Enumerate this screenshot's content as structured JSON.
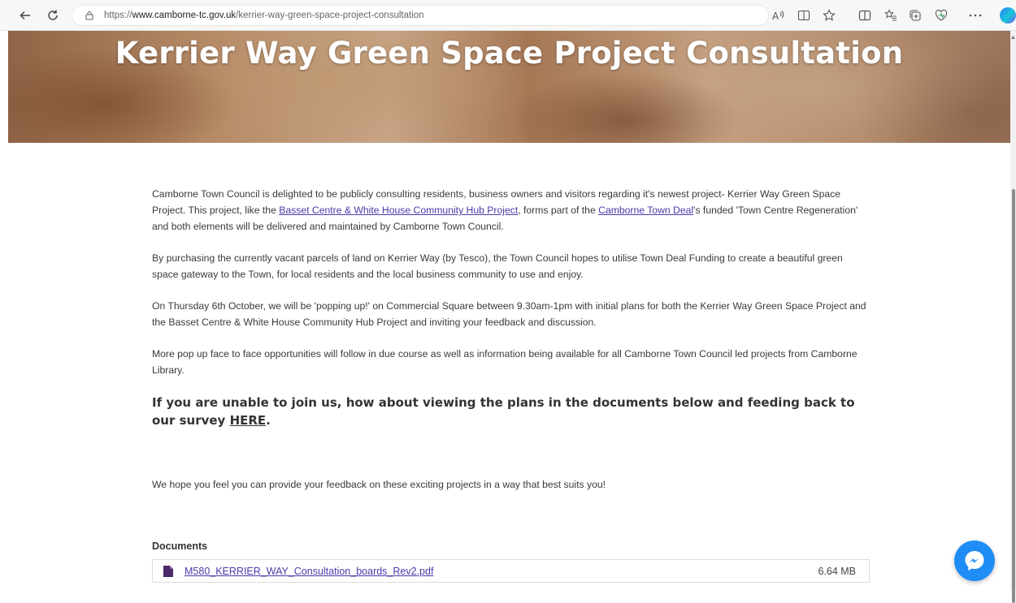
{
  "browser": {
    "url_scheme": "https://",
    "url_host": "www.camborne-tc.gov.uk",
    "url_path": "/kerrier-way-green-space-project-consultation",
    "toolbar_icons": [
      "read-aloud-icon",
      "immersive-reader-icon",
      "favorite-star-icon",
      "split-screen-icon",
      "favorites-icon",
      "collections-icon",
      "browser-essentials-icon",
      "more-menu-icon",
      "copilot-icon"
    ]
  },
  "hero": {
    "title": "Kerrier Way Green Space Project Consultation"
  },
  "content": {
    "p1_a": "Camborne Town Council is delighted to be publicly consulting residents, business owners and visitors regarding it's newest project- Kerrier Way Green Space Project. This project, like the ",
    "p1_link1": "Basset Centre & White House Community Hub Project",
    "p1_b": ", forms part of the ",
    "p1_link2": "Camborne Town Deal",
    "p1_c": "'s funded 'Town Centre Regeneration' and both elements will be delivered and maintained by Camborne Town Council.",
    "p2": "By purchasing the currently vacant parcels of land on Kerrier Way (by Tesco), the Town Council hopes to utilise Town Deal Funding to create a beautiful green space gateway to the Town, for local residents and the local business community to use and enjoy.",
    "p3": "On Thursday 6th October, we will be 'popping up!' on Commercial Square between 9.30am-1pm with initial plans for both the Kerrier Way Green Space Project and the Basset Centre & White House Community Hub Project and inviting your feedback and discussion.",
    "p4": "More pop up face to face opportunities will follow in due course as well as information being available for all Camborne Town Council led projects from Camborne Library.",
    "cta_text": "If you are unable to join us, how about viewing the plans in the documents below and feeding back to our survey ",
    "cta_link": "HERE",
    "cta_end": ".",
    "closing": "We hope you feel you can provide your feedback on these exciting projects in a way that best suits you!"
  },
  "documents": {
    "heading": "Documents",
    "items": [
      {
        "name": "M580_KERRIER_WAY_Consultation_boards_Rev2.pdf",
        "size": "6.64 MB"
      }
    ]
  },
  "colors": {
    "link": "#4a3aa8",
    "messenger": "#1f8df5"
  }
}
